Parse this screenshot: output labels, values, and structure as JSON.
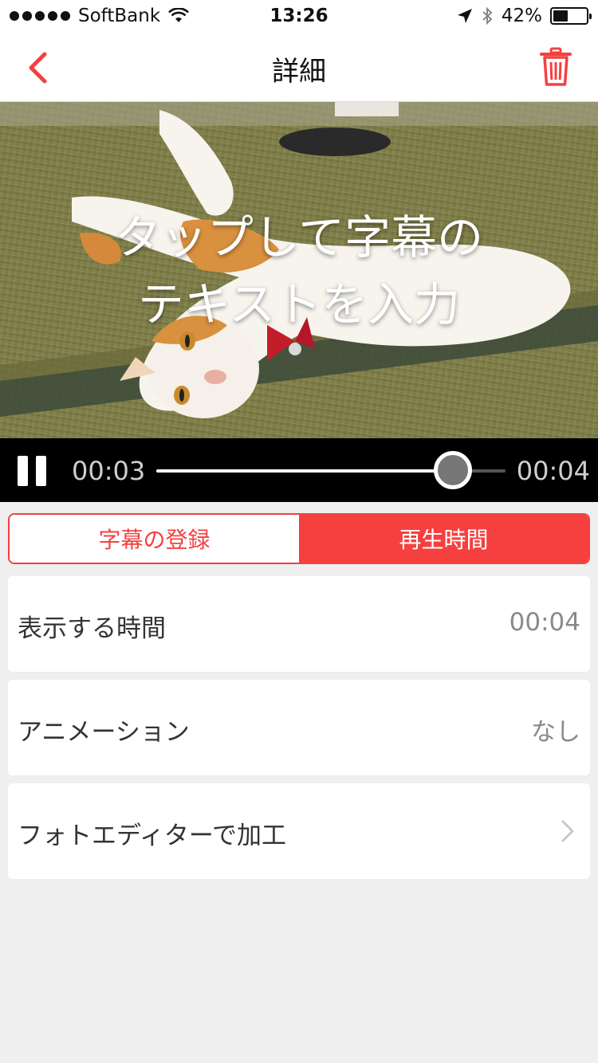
{
  "status_bar": {
    "carrier": "SoftBank",
    "time": "13:26",
    "battery": "42%",
    "battery_level": 0.42
  },
  "nav": {
    "title": "詳細"
  },
  "video": {
    "caption_line1": "タップして字幕の",
    "caption_line2": "テキストを入力"
  },
  "player": {
    "elapsed": "00:03",
    "duration": "00:04",
    "progress": 0.85
  },
  "tabs": [
    {
      "label": "字幕の登録",
      "selected": false
    },
    {
      "label": "再生時間",
      "selected": true
    }
  ],
  "rows": [
    {
      "label": "表示する時間",
      "value": "00:04"
    },
    {
      "label": "アニメーション",
      "value": "なし"
    },
    {
      "label": "フォトエディターで加工",
      "value": ""
    }
  ],
  "colors": {
    "accent": "#f5403f",
    "background": "#efefef"
  },
  "icons": {
    "back": "chevron-left-icon",
    "trash": "trash-icon",
    "pause": "pause-icon",
    "disclosure": "chevron-right-icon"
  }
}
